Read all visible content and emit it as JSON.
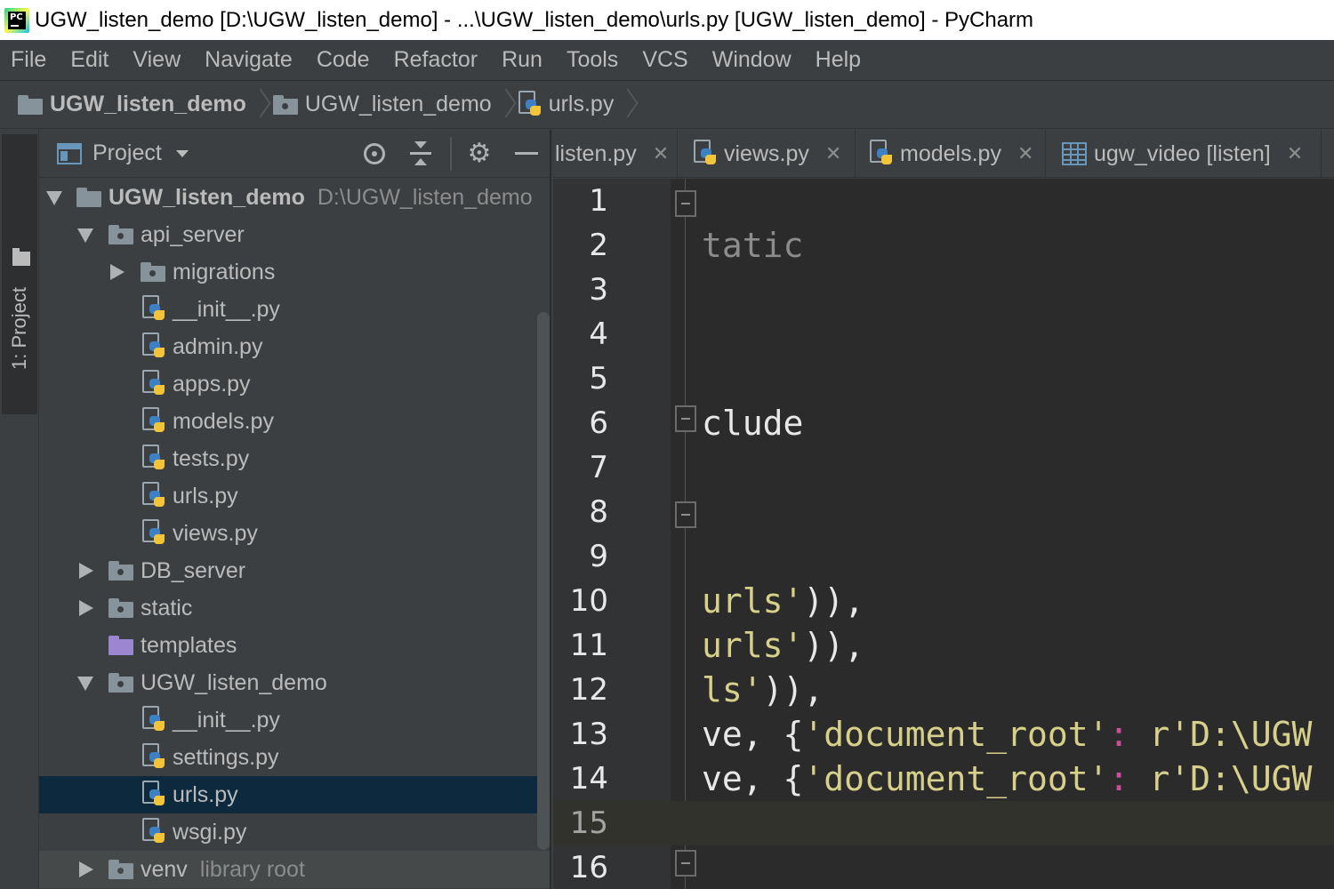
{
  "window": {
    "title": "UGW_listen_demo [D:\\UGW_listen_demo] - ...\\UGW_listen_demo\\urls.py [UGW_listen_demo] - PyCharm",
    "app_icon_text": "PC"
  },
  "menu": [
    "File",
    "Edit",
    "View",
    "Navigate",
    "Code",
    "Refactor",
    "Run",
    "Tools",
    "VCS",
    "Window",
    "Help"
  ],
  "breadcrumb": [
    "UGW_listen_demo",
    "UGW_listen_demo",
    "urls.py"
  ],
  "tool_strip": {
    "project_tab": "1: Project"
  },
  "project_panel": {
    "title": "Project",
    "tree": [
      {
        "label": "UGW_listen_demo",
        "hint": "D:\\UGW_listen_demo"
      },
      {
        "label": "api_server"
      },
      {
        "label": "migrations"
      },
      {
        "label": "__init__.py"
      },
      {
        "label": "admin.py"
      },
      {
        "label": "apps.py"
      },
      {
        "label": "models.py"
      },
      {
        "label": "tests.py"
      },
      {
        "label": "urls.py"
      },
      {
        "label": "views.py"
      },
      {
        "label": "DB_server"
      },
      {
        "label": "static"
      },
      {
        "label": "templates"
      },
      {
        "label": "UGW_listen_demo"
      },
      {
        "label": "__init__.py"
      },
      {
        "label": "settings.py"
      },
      {
        "label": "urls.py"
      },
      {
        "label": "wsgi.py"
      },
      {
        "label": "venv",
        "hint": "library root"
      }
    ]
  },
  "tabs": [
    {
      "label": "listen.py"
    },
    {
      "label": "views.py"
    },
    {
      "label": "models.py"
    },
    {
      "label": "ugw_video [listen]"
    }
  ],
  "editor": {
    "current_line": 15,
    "lines": [
      {
        "n": "1",
        "code": []
      },
      {
        "n": "2",
        "code": [
          {
            "t": "tatic",
            "c": "gray"
          }
        ]
      },
      {
        "n": "3",
        "code": []
      },
      {
        "n": "4",
        "code": []
      },
      {
        "n": "5",
        "code": []
      },
      {
        "n": "6",
        "code": [
          {
            "t": "clude",
            "c": "white"
          }
        ]
      },
      {
        "n": "7",
        "code": []
      },
      {
        "n": "8",
        "code": []
      },
      {
        "n": "9",
        "code": []
      },
      {
        "n": "10",
        "code": [
          {
            "t": "urls'",
            "c": "str"
          },
          {
            "t": ")),",
            "c": "white"
          }
        ]
      },
      {
        "n": "11",
        "code": [
          {
            "t": "urls'",
            "c": "str"
          },
          {
            "t": ")),",
            "c": "white"
          }
        ]
      },
      {
        "n": "12",
        "code": [
          {
            "t": "ls'",
            "c": "str"
          },
          {
            "t": ")),",
            "c": "white"
          }
        ]
      },
      {
        "n": "13",
        "code": [
          {
            "t": "ve, {",
            "c": "white"
          },
          {
            "t": "'document_root'",
            "c": "str"
          },
          {
            "t": ": ",
            "c": "pink"
          },
          {
            "t": "r'D:\\UGW",
            "c": "str"
          }
        ]
      },
      {
        "n": "14",
        "code": [
          {
            "t": "ve, {",
            "c": "white"
          },
          {
            "t": "'document_root'",
            "c": "str"
          },
          {
            "t": ": ",
            "c": "pink"
          },
          {
            "t": "r'D:\\UGW",
            "c": "str"
          }
        ]
      },
      {
        "n": "15",
        "code": []
      },
      {
        "n": "16",
        "code": []
      }
    ]
  }
}
